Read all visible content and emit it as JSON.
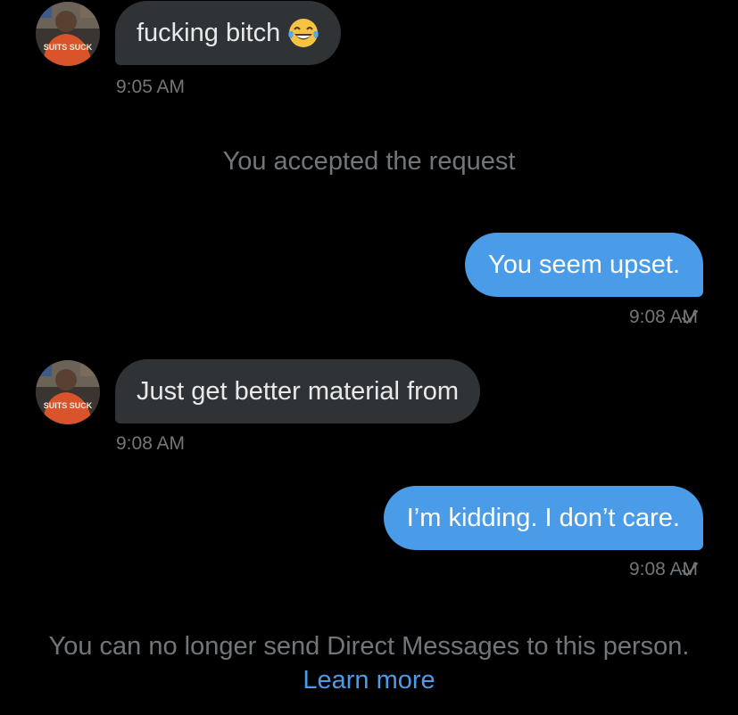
{
  "conversation": {
    "messages": [
      {
        "direction": "incoming",
        "text": "fucking bitch",
        "emoji": "face-with-tears-of-joy",
        "time": "9:05 AM"
      },
      {
        "direction": "outgoing",
        "text": "You seem upset.",
        "time": "9:08 AM"
      },
      {
        "direction": "incoming",
        "text": "Just get better material from",
        "time": "9:08 AM"
      },
      {
        "direction": "outgoing",
        "text": "I’m kidding. I don’t care.",
        "time": "9:08 AM"
      }
    ],
    "system_message": "You accepted the request",
    "avatar_text": "SUITS SUCK",
    "footer": {
      "text": "You can no longer send Direct Messages to this person.",
      "link": "Learn more"
    }
  },
  "colors": {
    "background": "#000000",
    "incoming_bubble": "#2f3336",
    "outgoing_bubble": "#4a9be8",
    "timestamp": "#71767b",
    "link": "#4a9be8"
  }
}
